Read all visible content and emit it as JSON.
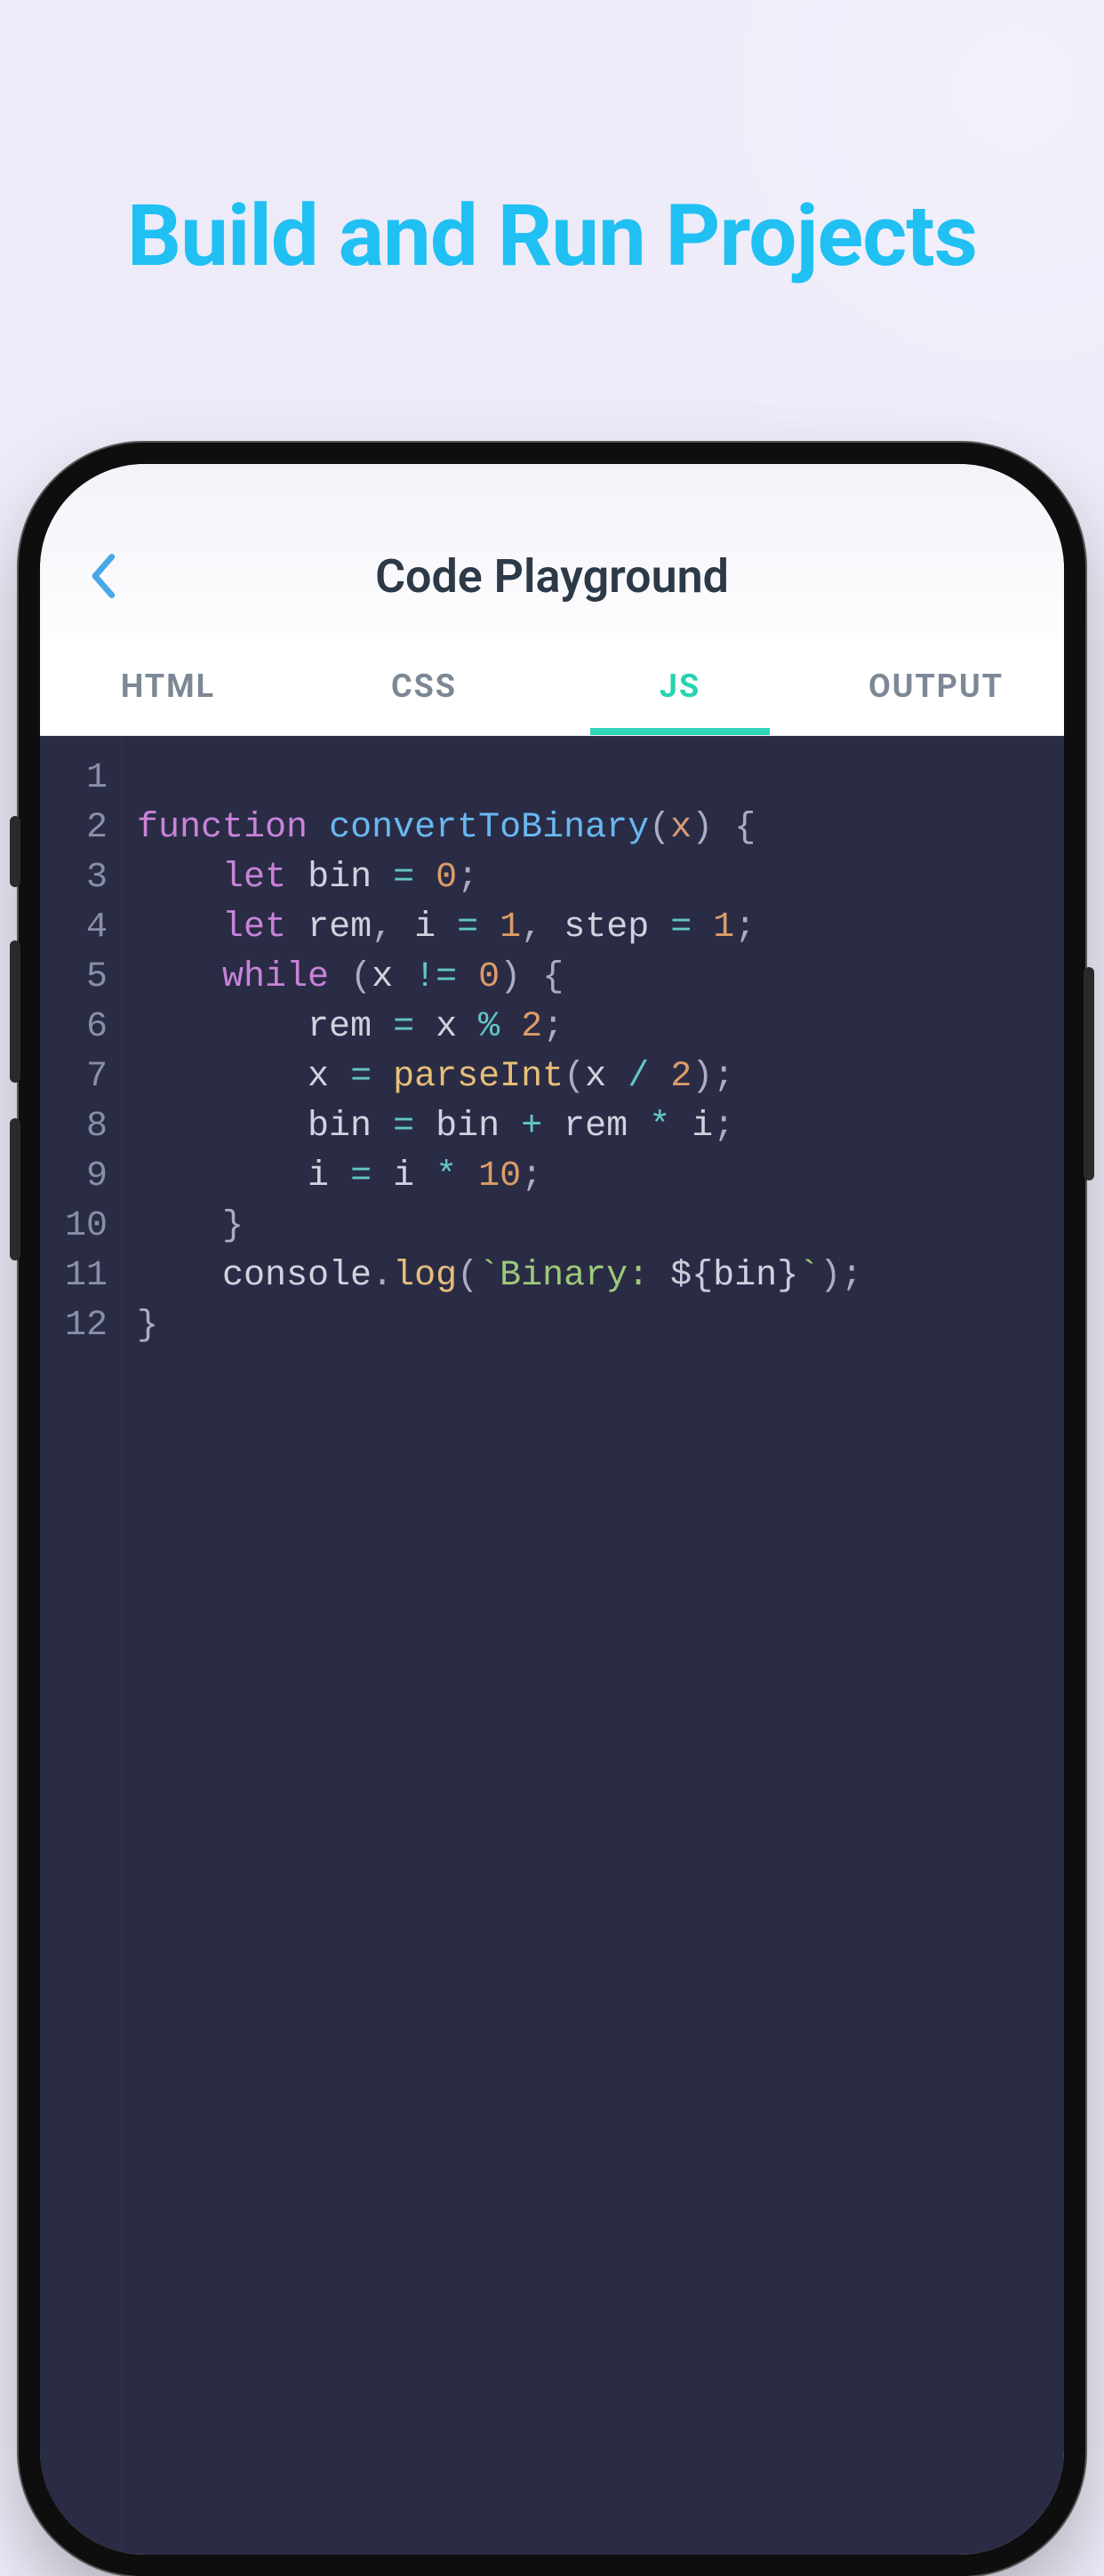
{
  "hero": {
    "title": "Build and Run Projects"
  },
  "header": {
    "title": "Code Playground",
    "back_label": "Back"
  },
  "tabs": [
    {
      "id": "html",
      "label": "HTML",
      "active": false
    },
    {
      "id": "css",
      "label": "CSS",
      "active": false
    },
    {
      "id": "js",
      "label": "JS",
      "active": true
    },
    {
      "id": "output",
      "label": "OUTPUT",
      "active": false
    }
  ],
  "editor": {
    "language": "javascript",
    "line_count": 12,
    "line_numbers": [
      "1",
      "2",
      "3",
      "4",
      "5",
      "6",
      "7",
      "8",
      "9",
      "10",
      "11",
      "12"
    ],
    "raw": "function convertToBinary(x) {\n    let bin = 0;\n    let rem, i = 1, step = 1;\n    while (x != 0) {\n        rem = x % 2;\n        x = parseInt(x / 2);\n        bin = bin + rem * i;\n        i = i * 10;\n    }\n    console.log(`Binary: ${bin}`);\n}",
    "tokens": [
      [],
      [
        [
          "kw",
          "function"
        ],
        [
          "sp",
          " "
        ],
        [
          "fn",
          "convertToBinary"
        ],
        [
          "punc",
          "("
        ],
        [
          "param",
          "x"
        ],
        [
          "punc",
          ")"
        ],
        [
          "sp",
          " "
        ],
        [
          "punc",
          "{"
        ]
      ],
      [
        [
          "sp",
          "    "
        ],
        [
          "kw",
          "let"
        ],
        [
          "sp",
          " "
        ],
        [
          "var",
          "bin"
        ],
        [
          "sp",
          " "
        ],
        [
          "op",
          "="
        ],
        [
          "sp",
          " "
        ],
        [
          "num",
          "0"
        ],
        [
          "punc",
          ";"
        ]
      ],
      [
        [
          "sp",
          "    "
        ],
        [
          "kw",
          "let"
        ],
        [
          "sp",
          " "
        ],
        [
          "var",
          "rem"
        ],
        [
          "punc",
          ","
        ],
        [
          "sp",
          " "
        ],
        [
          "var",
          "i"
        ],
        [
          "sp",
          " "
        ],
        [
          "op",
          "="
        ],
        [
          "sp",
          " "
        ],
        [
          "num",
          "1"
        ],
        [
          "punc",
          ","
        ],
        [
          "sp",
          " "
        ],
        [
          "var",
          "step"
        ],
        [
          "sp",
          " "
        ],
        [
          "op",
          "="
        ],
        [
          "sp",
          " "
        ],
        [
          "num",
          "1"
        ],
        [
          "punc",
          ";"
        ]
      ],
      [
        [
          "sp",
          "    "
        ],
        [
          "kw",
          "while"
        ],
        [
          "sp",
          " "
        ],
        [
          "punc",
          "("
        ],
        [
          "var",
          "x"
        ],
        [
          "sp",
          " "
        ],
        [
          "op",
          "!="
        ],
        [
          "sp",
          " "
        ],
        [
          "num",
          "0"
        ],
        [
          "punc",
          ")"
        ],
        [
          "sp",
          " "
        ],
        [
          "punc",
          "{"
        ]
      ],
      [
        [
          "sp",
          "        "
        ],
        [
          "var",
          "rem"
        ],
        [
          "sp",
          " "
        ],
        [
          "op",
          "="
        ],
        [
          "sp",
          " "
        ],
        [
          "var",
          "x"
        ],
        [
          "sp",
          " "
        ],
        [
          "op",
          "%"
        ],
        [
          "sp",
          " "
        ],
        [
          "num",
          "2"
        ],
        [
          "punc",
          ";"
        ]
      ],
      [
        [
          "sp",
          "        "
        ],
        [
          "var",
          "x"
        ],
        [
          "sp",
          " "
        ],
        [
          "op",
          "="
        ],
        [
          "sp",
          " "
        ],
        [
          "call2",
          "parseInt"
        ],
        [
          "punc",
          "("
        ],
        [
          "var",
          "x"
        ],
        [
          "sp",
          " "
        ],
        [
          "op",
          "/"
        ],
        [
          "sp",
          " "
        ],
        [
          "num",
          "2"
        ],
        [
          "punc",
          ")"
        ],
        [
          "punc",
          ";"
        ]
      ],
      [
        [
          "sp",
          "        "
        ],
        [
          "var",
          "bin"
        ],
        [
          "sp",
          " "
        ],
        [
          "op",
          "="
        ],
        [
          "sp",
          " "
        ],
        [
          "var",
          "bin"
        ],
        [
          "sp",
          " "
        ],
        [
          "op",
          "+"
        ],
        [
          "sp",
          " "
        ],
        [
          "var",
          "rem"
        ],
        [
          "sp",
          " "
        ],
        [
          "op",
          "*"
        ],
        [
          "sp",
          " "
        ],
        [
          "var",
          "i"
        ],
        [
          "punc",
          ";"
        ]
      ],
      [
        [
          "sp",
          "        "
        ],
        [
          "var",
          "i"
        ],
        [
          "sp",
          " "
        ],
        [
          "op",
          "="
        ],
        [
          "sp",
          " "
        ],
        [
          "var",
          "i"
        ],
        [
          "sp",
          " "
        ],
        [
          "op",
          "*"
        ],
        [
          "sp",
          " "
        ],
        [
          "num",
          "10"
        ],
        [
          "punc",
          ";"
        ]
      ],
      [
        [
          "sp",
          "    "
        ],
        [
          "punc",
          "}"
        ]
      ],
      [
        [
          "sp",
          "    "
        ],
        [
          "obj",
          "console"
        ],
        [
          "punc",
          "."
        ],
        [
          "call2",
          "log"
        ],
        [
          "punc",
          "("
        ],
        [
          "strp",
          "`"
        ],
        [
          "str",
          "Binary: "
        ],
        [
          "intp",
          "${"
        ],
        [
          "var",
          "bin"
        ],
        [
          "intp",
          "}"
        ],
        [
          "strp",
          "`"
        ],
        [
          "punc",
          ")"
        ],
        [
          "punc",
          ";"
        ]
      ],
      [
        [
          "punc",
          "}"
        ]
      ]
    ]
  },
  "colors": {
    "hero_text": "#21c0f3",
    "tab_active": "#28d2b0",
    "editor_bg": "#2a2c45"
  }
}
